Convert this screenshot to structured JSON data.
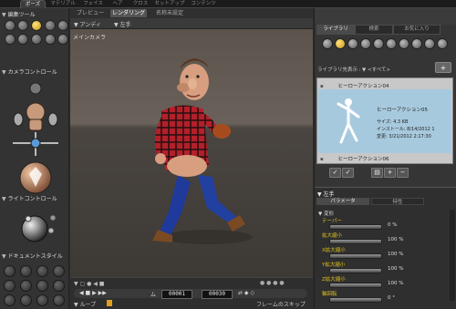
{
  "top_tabs": [
    "ポーズ",
    "マテリアル",
    "フェイス",
    "ヘア",
    "クロス",
    "セットアップ",
    "コンテンツ"
  ],
  "viewport_tabs": [
    "プレビュー",
    "レンダリング",
    "名称未設定"
  ],
  "viewport_toolbar": {
    "mode": "アンディ",
    "target": "左手"
  },
  "camera_name": "メインカメラ",
  "left_panel": {
    "edit_tools_title": "編集ツール",
    "camera_control_title": "カメラコントロール",
    "light_control_title": "ライトコントロール",
    "document_style_title": "ドキュメントスタイル"
  },
  "timeline": {
    "current_frame": "00001",
    "total_frames": "00030",
    "loop_label": "ループ",
    "skip_label": "フレームのスキップ"
  },
  "right_panel": {
    "tabs": [
      "ライブラリ",
      "検索",
      "お気に入り"
    ],
    "library_label": "ライブラリ先表示 :",
    "library_filter": "<すべて>",
    "items": [
      {
        "name": "ヒーローアクション04"
      },
      {
        "name": "ヒーローアクション05",
        "selected": true,
        "size": "サイズ: 4.3 KB",
        "installed": "インストール: 8/14/2012 1",
        "modified": "変更: 3/21/2012 2:17:30"
      },
      {
        "name": "ヒーローアクション06"
      }
    ],
    "params_title": "左手",
    "params_tabs": [
      "パラメータ",
      "特性"
    ],
    "transform_label": "変形",
    "sliders": [
      {
        "label": "テーパー",
        "value": "0 %"
      },
      {
        "label": "拡大縮小",
        "value": "100 %"
      },
      {
        "label": "X拡大縮小",
        "value": "100 %"
      },
      {
        "label": "Y拡大縮小",
        "value": "100 %"
      },
      {
        "label": "Z拡大縮小",
        "value": "100 %"
      },
      {
        "label": "軸回転",
        "value": "0 °"
      }
    ]
  },
  "colors": {
    "accent": "#e0b830",
    "selection": "#a7c9de",
    "shirt": "#b3202a",
    "pants": "#1f3a9a"
  }
}
